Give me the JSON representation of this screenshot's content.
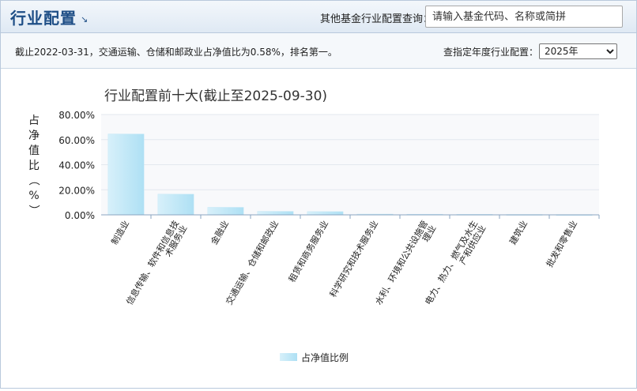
{
  "header": {
    "title": "行业配置",
    "more_icon": "↘",
    "search_label": "其他基金行业配置查询：",
    "search_placeholder": "请输入基金代码、名称或简拼"
  },
  "info": {
    "summary": "截止2022-03-31，交通运输、仓储和邮政业占净值比为0.58%，排名第一。",
    "year_label": "查指定年度行业配置：",
    "year_selected": "2025年"
  },
  "colors": {
    "bar_top": "#d7f0fa",
    "bar_bottom": "#aee0f4",
    "header_title": "#1e4e86"
  },
  "chart_data": {
    "type": "bar",
    "title": "行业配置前十大(截止至2025-09-30)",
    "ylabel": "占净值比（%）",
    "xlabel": "",
    "ylim": [
      0,
      80
    ],
    "yticks": [
      "0.00%",
      "20.00%",
      "40.00%",
      "60.00%",
      "80.00%"
    ],
    "grid": true,
    "legend_position": "bottom-center",
    "categories": [
      "制造业",
      "信息传输、软件和信息技术服务业",
      "金融业",
      "交通运输、仓储和邮政业",
      "租赁和商务服务业",
      "科学研究和技术服务业",
      "水利、环境和公共设施管理业",
      "电力、热力、燃气及水生产和供应业",
      "建筑业",
      "批发和零售业"
    ],
    "series": [
      {
        "name": "占净值比例",
        "values": [
          64.5,
          16.5,
          6.0,
          2.8,
          2.6,
          0.6,
          0.5,
          0.4,
          0.3,
          0.2
        ]
      }
    ]
  }
}
